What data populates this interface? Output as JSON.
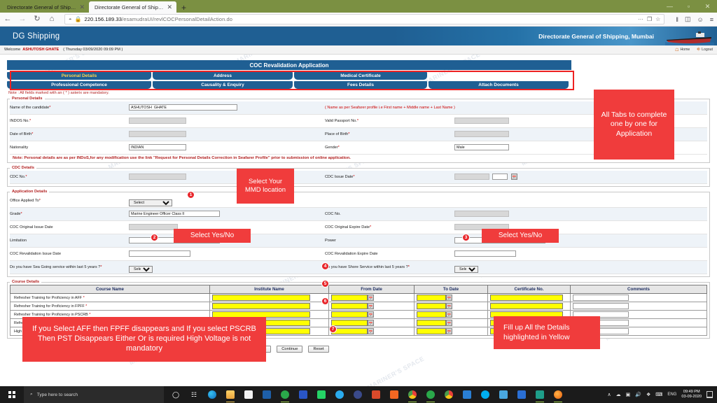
{
  "browser": {
    "tabs": [
      {
        "title": "Directorate General of Shipping : G...",
        "close": "✕"
      },
      {
        "title": "Directorate General of Shipping",
        "close": "✕"
      }
    ],
    "newtab_label": "+",
    "window_controls": {
      "minimize": "—",
      "maximize": "▫",
      "close": "✕"
    },
    "nav": {
      "back": "←",
      "forward": "→",
      "reload": "↻",
      "home": "⌂"
    },
    "url": {
      "host": "220.156.189.33",
      "path": "/esamudraUI/revlCOCPersonalDetailAction.do"
    },
    "url_actions": {
      "more": "···",
      "reader": "❐",
      "bookmark": "☆"
    },
    "toolbar_icons": {
      "library": "‖",
      "sidebar": "◫",
      "account": "☺",
      "menu": "≡"
    }
  },
  "site": {
    "brand": "DG Shipping",
    "title": "Directorate General of Shipping, Mumbai",
    "welcome_prefix": "Welcome",
    "welcome_user": "ASHUTOSH GHATE",
    "welcome_date": "( Thursday 03/09/2020 09:09 PM )",
    "links": [
      {
        "label": "Home",
        "icon": "home-icon"
      },
      {
        "label": "Logout",
        "icon": "logout-icon"
      }
    ]
  },
  "application": {
    "header": "COC Revalidation Application",
    "tabs_row1": [
      "Personal Details",
      "Address",
      "Medical Certificate"
    ],
    "tabs_row2": [
      "Professional Competence",
      "Causality & Enquiry",
      "Fees Details",
      "Attach Documents"
    ],
    "active_tab": "Personal Details",
    "mandatory_note": "Note : All fields marked with an ( * ) asterix are mandatory."
  },
  "personal_details": {
    "legend": "Personal Details",
    "fields": [
      {
        "label": "Name of the candidate",
        "required": true,
        "value": "ASHUTOSH  GHATE"
      },
      {
        "label": "INDOS No.",
        "required": true,
        "value": "",
        "masked": true
      },
      {
        "label": "Date of Birth",
        "required": true,
        "value": "",
        "masked": true
      },
      {
        "label": "Nationality",
        "required": false,
        "value": "INDIAN"
      }
    ],
    "right_fields": [
      {
        "label": "Valid Passport No.",
        "required": true,
        "value": "",
        "masked": true
      },
      {
        "label": "Place of Birth",
        "required": true,
        "value": "",
        "masked": true
      },
      {
        "label": "Gender",
        "required": true,
        "value": "Male"
      }
    ],
    "name_hint": "( Name as per Seafarer profile  i.e First name + Middle name + Last Name )",
    "footer_note": "Note: Personal details are as per INDoS,for any modification use the link \"Request for Personal Details Correction in Seafarer Profile\" prior to submission of online application."
  },
  "cdc_details": {
    "legend": "CDC Details",
    "left": {
      "label": "CDC No.",
      "required": true,
      "value": "",
      "masked": true
    },
    "right": {
      "label": "CDC Issue Date",
      "required": true,
      "value": "",
      "masked": true,
      "calendar_icon": "calendar-icon"
    }
  },
  "application_details": {
    "legend": "Application Details",
    "left": [
      {
        "label": "Office Applied To",
        "required": true,
        "type": "select",
        "value": "Select"
      },
      {
        "label": "Grade",
        "required": true,
        "type": "text",
        "value": "Marine Engineer Officer Class II"
      },
      {
        "label": "COC Original Issue Date",
        "required": false,
        "type": "text",
        "value": "",
        "masked": true
      },
      {
        "label": "Limitation",
        "required": false,
        "type": "text",
        "value": ""
      },
      {
        "label": "COC Revalidation Issue Date",
        "required": false,
        "type": "text",
        "value": ""
      },
      {
        "label": "Do you have Sea Going service within last 5 years ?",
        "required": true,
        "type": "select",
        "value": "Select"
      }
    ],
    "right": [
      {
        "label": "COC No.",
        "required": false,
        "type": "text",
        "value": "",
        "masked": true
      },
      {
        "label": "COC Original Expire Date",
        "required": true,
        "type": "text",
        "value": "",
        "masked": true
      },
      {
        "label": "Power",
        "required": false,
        "type": "text",
        "value": ""
      },
      {
        "label": "COC Revalidation Expire Date",
        "required": false,
        "type": "text",
        "value": ""
      },
      {
        "label": "Do you have Shore Service within last 5 years ?",
        "required": true,
        "type": "select",
        "value": "Select"
      }
    ]
  },
  "course_details": {
    "legend": "Course Details",
    "columns": [
      "Course Name",
      "Institute Name",
      "From Date",
      "To Date",
      "Certificate No.",
      "Comments"
    ],
    "rows": [
      {
        "name": "Refresher Training for Proficiency in AFF",
        "required": true
      },
      {
        "name": "Refresher Training for Proficiency in FPFF",
        "required": true
      },
      {
        "name": "Refresher Training for Proficiency in PSCRB",
        "required": true
      },
      {
        "name": "Refresher Training for Proficiency in PST",
        "required": true
      },
      {
        "name": "High Voltage Safety and Switch Gear",
        "required": false
      }
    ]
  },
  "buttons": [
    {
      "label": "Back"
    },
    {
      "label": "Continue"
    },
    {
      "label": "Reset"
    }
  ],
  "annotations": {
    "tabs_note": "All Tabs to complete one by one for Application",
    "mmd_note": "Select Your MMD location",
    "sea_service_note": "Select Yes/No",
    "shore_service_note": "Select Yes/No",
    "course_note": "If you Select AFF then FPFF disappears and If you select PSCRB Then PST Disappears Either Or is required High Voltage is not mandatory",
    "yellow_note": "Fill up All the Details highlighted in Yellow",
    "badges": [
      "1",
      "2",
      "3",
      "4",
      "5",
      "6",
      "7"
    ]
  },
  "watermark": "MARINER'S SPACE",
  "taskbar": {
    "search_placeholder": "Type here to search",
    "icons": [
      "cortana-icon",
      "task-view-icon",
      "edge-icon",
      "file-explorer-icon",
      "store-icon",
      "mail-icon",
      "app-green-icon",
      "powershell-icon",
      "whatsapp-icon",
      "telegram-icon",
      "lock-icon",
      "app-red-icon",
      "app-orange-icon",
      "chrome-alt-icon",
      "utorrent-icon",
      "chrome-icon",
      "vscode-icon",
      "skype-icon",
      "cloud-icon",
      "blue-app-icon",
      "teal-app-icon",
      "firefox-icon"
    ],
    "tray": {
      "chevron": "∧",
      "cloud": "☁",
      "network": "▣",
      "volume": "🔊",
      "dropbox": "❖",
      "keyboard": "⌨",
      "language": "ENG"
    },
    "clock_time": "09:49 PM",
    "clock_date": "03-09-2020",
    "show_desktop": "show-desktop-icon"
  }
}
